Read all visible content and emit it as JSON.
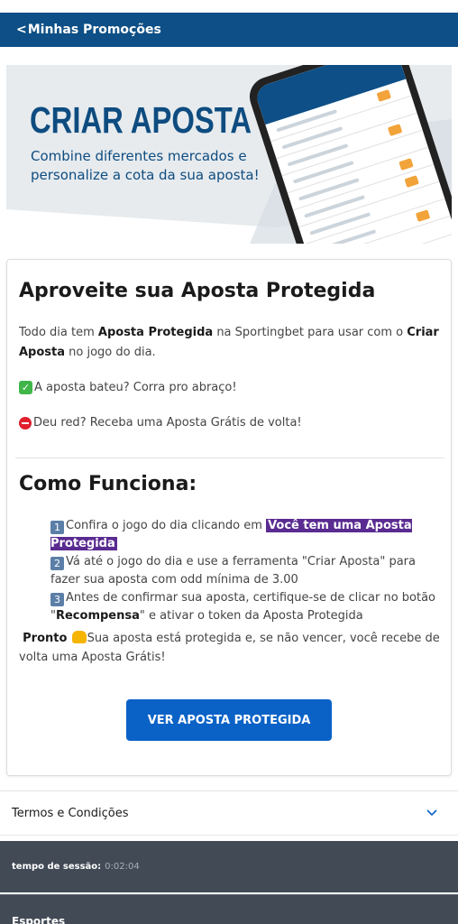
{
  "header": {
    "back_glyph": "<",
    "title": "Minhas Promoções"
  },
  "banner": {
    "title": "CRIAR APOSTA",
    "subtitle": "Combine diferentes mercados e personalize a cota da sua aposta!",
    "brand_color": "#0e4c80"
  },
  "card": {
    "title": "Aproveite sua Aposta Protegida",
    "intro": {
      "p1": "Todo dia tem ",
      "b1": "Aposta Protegida",
      "p2": " na Sportingbet para usar com o ",
      "b2": "Criar Aposta",
      "p3": " no jogo do dia."
    },
    "line_win": "A aposta bateu? Corra pro abraço!",
    "line_loss": "Deu red? Receba uma Aposta Grátis de volta!",
    "how_title": "Como Funciona:",
    "steps": [
      {
        "num": "1",
        "text": "Confira o jogo do dia clicando em ",
        "highlight": "Você tem uma Aposta Protegida"
      },
      {
        "num": "2",
        "text": "Vá até o jogo do dia e use a ferramenta \"Criar Aposta\" para fazer sua aposta com odd mínima de 3.00"
      },
      {
        "num": "3",
        "text_before": "Antes de confirmar sua aposta, certifique-se de clicar no botão \"",
        "bold": "Recompensa",
        "text_after": "\" e ativar o token da Aposta Protegida"
      }
    ],
    "pronto_bold": "Pronto",
    "pronto_text": "Sua aposta está protegida e, se não vencer, você recebe de volta uma Aposta Grátis!",
    "button_label": "VER APOSTA PROTEGIDA",
    "highlight_color": "#5a2b91",
    "button_color": "#0a62c7"
  },
  "terms": {
    "label": "Termos e Condições"
  },
  "session": {
    "label": "tempo de sessão:",
    "value": "0:02:04"
  },
  "footer": {
    "label": "Esportes"
  }
}
